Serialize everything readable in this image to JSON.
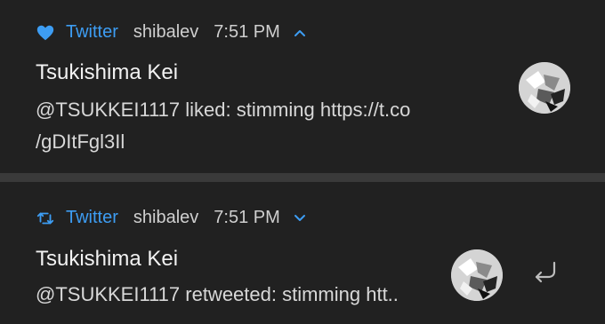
{
  "notifications": [
    {
      "app": "Twitter",
      "user": "shibalev",
      "time": "7:51 PM",
      "title": "Tsukishima Kei",
      "text": "@TSUKKEI1117 liked: stimming https://t.co /gDItFgl3Il",
      "icons": {
        "action": "heart-icon",
        "chevron": "chevron-up-icon"
      }
    },
    {
      "app": "Twitter",
      "user": "shibalev",
      "time": "7:51 PM",
      "title": "Tsukishima Kei",
      "text": "@TSUKKEI1117 retweeted: stimming htt..",
      "icons": {
        "action": "retweet-icon",
        "chevron": "chevron-down-icon",
        "reply": "reply-icon"
      }
    }
  ],
  "colors": {
    "accent": "#3d9df3",
    "background": "#212121",
    "divider": "#3a3a3a",
    "title": "#f2f2f2",
    "body": "#d8d8d8"
  }
}
